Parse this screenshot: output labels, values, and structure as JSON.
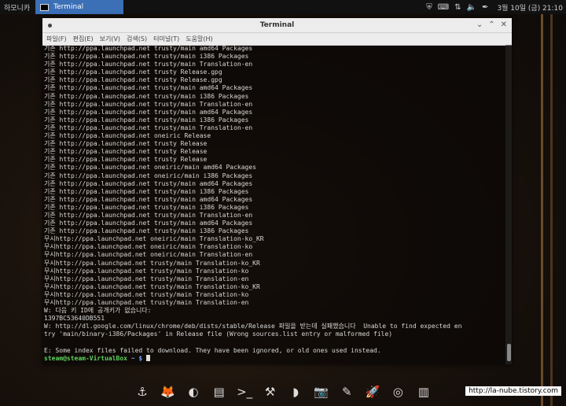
{
  "top_panel": {
    "label": "하모니카",
    "task_title": "Terminal",
    "clock": "3월 10일 (금) 21:10"
  },
  "window": {
    "title": "Terminal",
    "menu": [
      "파일(F)",
      "편집(E)",
      "보기(V)",
      "검색(S)",
      "터미널(T)",
      "도움말(H)"
    ]
  },
  "terminal": {
    "lines": [
      "기존 http://ppa.launchpad.net trusty/main amd64 Packages",
      "기존 http://ppa.launchpad.net trusty/main i386 Packages",
      "기존 http://ppa.launchpad.net trusty/main Translation-en",
      "기존 http://ppa.launchpad.net trusty Release.gpg",
      "기존 http://ppa.launchpad.net trusty Release.gpg",
      "기존 http://ppa.launchpad.net trusty/main amd64 Packages",
      "기존 http://ppa.launchpad.net trusty/main i386 Packages",
      "기존 http://ppa.launchpad.net trusty/main Translation-en",
      "기존 http://ppa.launchpad.net trusty/main amd64 Packages",
      "기존 http://ppa.launchpad.net trusty/main i386 Packages",
      "기존 http://ppa.launchpad.net trusty/main Translation-en",
      "기존 http://ppa.launchpad.net oneiric Release",
      "기존 http://ppa.launchpad.net trusty Release",
      "기존 http://ppa.launchpad.net trusty Release",
      "기존 http://ppa.launchpad.net trusty Release",
      "기존 http://ppa.launchpad.net oneiric/main amd64 Packages",
      "기존 http://ppa.launchpad.net oneiric/main i386 Packages",
      "기존 http://ppa.launchpad.net trusty/main amd64 Packages",
      "기존 http://ppa.launchpad.net trusty/main i386 Packages",
      "기존 http://ppa.launchpad.net trusty/main amd64 Packages",
      "기존 http://ppa.launchpad.net trusty/main i386 Packages",
      "기존 http://ppa.launchpad.net trusty/main Translation-en",
      "기존 http://ppa.launchpad.net trusty/main amd64 Packages",
      "기존 http://ppa.launchpad.net trusty/main i386 Packages",
      "무시http://ppa.launchpad.net oneiric/main Translation-ko_KR",
      "무시http://ppa.launchpad.net oneiric/main Translation-ko",
      "무시http://ppa.launchpad.net oneiric/main Translation-en",
      "무시http://ppa.launchpad.net trusty/main Translation-ko_KR",
      "무시http://ppa.launchpad.net trusty/main Translation-ko",
      "무시http://ppa.launchpad.net trusty/main Translation-en",
      "무시http://ppa.launchpad.net trusty/main Translation-ko_KR",
      "무시http://ppa.launchpad.net trusty/main Translation-ko",
      "무시http://ppa.launchpad.net trusty/main Translation-en",
      "W: 다음 키 ID에 공개키가 없습니다:",
      "1397BC53640DB551",
      "W: http://dl.google.com/linux/chrome/deb/dists/stable/Release 파일을 받는데 실패했습니다  Unable to find expected en",
      "try 'main/binary-i386/Packages' in Release file (Wrong sources.list entry or malformed file)",
      "",
      "E: Some index files failed to download. They have been ignored, or old ones used instead."
    ],
    "prompt_user": "steam@steam-VirtualBox",
    "prompt_path": " ~ $ "
  },
  "dock": {
    "items": [
      {
        "name": "anchor-icon",
        "glyph": "⚓"
      },
      {
        "name": "firefox-icon",
        "glyph": "🦊"
      },
      {
        "name": "thunderbird-icon",
        "glyph": "◐"
      },
      {
        "name": "file-manager-icon",
        "glyph": "▤"
      },
      {
        "name": "terminal-icon",
        "glyph": ">_"
      },
      {
        "name": "settings-tools-icon",
        "glyph": "⚒"
      },
      {
        "name": "shape-icon",
        "glyph": "◗"
      },
      {
        "name": "camera-icon",
        "glyph": "📷"
      },
      {
        "name": "pen-icon",
        "glyph": "✎"
      },
      {
        "name": "rocket-icon",
        "glyph": "🚀"
      },
      {
        "name": "target-icon",
        "glyph": "◎"
      },
      {
        "name": "equalizer-icon",
        "glyph": "▥"
      }
    ]
  },
  "watermark": "http://la-nube.tistory.com"
}
